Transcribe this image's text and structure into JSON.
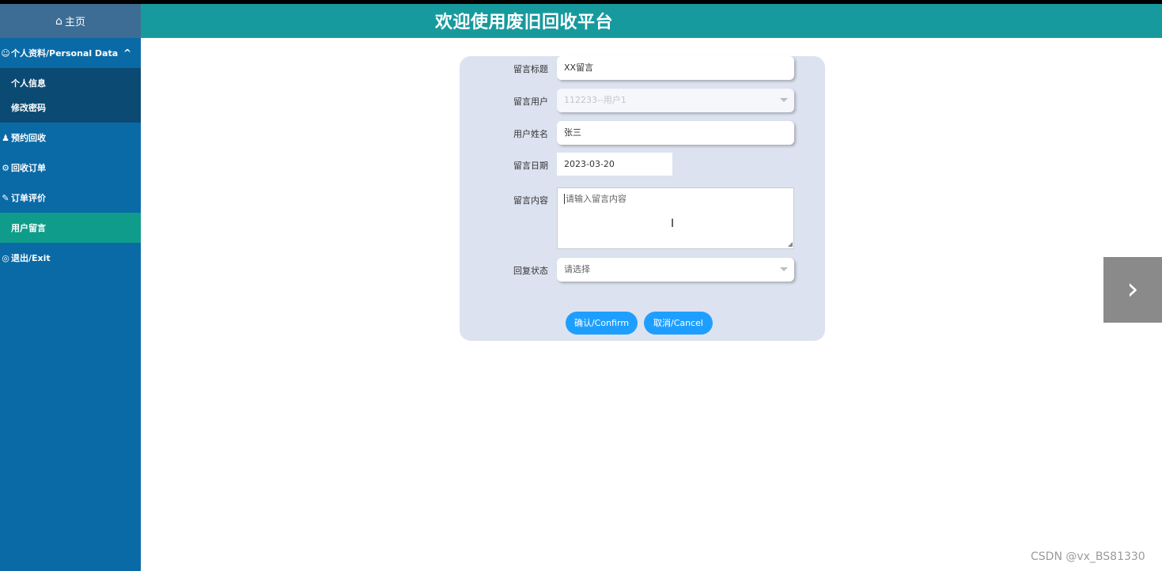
{
  "header": {
    "title": "欢迎使用废旧回收平台"
  },
  "sidebar": {
    "home": {
      "icon": "⌂",
      "label": "主页"
    },
    "group": {
      "label": "个人资料/Personal Data",
      "chevron": "^"
    },
    "sub_items": [
      {
        "label": "个人信息"
      },
      {
        "label": "修改密码"
      }
    ],
    "items": [
      {
        "label": "预约回收"
      },
      {
        "label": "回收订单"
      },
      {
        "label": "订单评价"
      },
      {
        "label": "用户留言"
      },
      {
        "label": "退出/Exit"
      }
    ],
    "active_item": "用户留言"
  },
  "form": {
    "title": {
      "label": "留言标题",
      "value": "XX留言"
    },
    "user": {
      "label": "留言用户",
      "value": "112233--用户1"
    },
    "name": {
      "label": "用户姓名",
      "value": "张三"
    },
    "date": {
      "label": "留言日期",
      "value": "2023-03-20"
    },
    "content": {
      "label": "留言内容",
      "placeholder": "请输入留言内容"
    },
    "status": {
      "label": "回复状态",
      "placeholder": "请选择"
    },
    "confirm_label": "确认/Confirm",
    "cancel_label": "取消/Cancel"
  },
  "next_button": {
    "icon": "›"
  },
  "watermark": "CSDN @vx_BS81330",
  "colors": {
    "sidebar": "#0a6aa6",
    "header": "#179a9e",
    "active": "#109c8a",
    "card": "#dde2f0",
    "button": "#1e9fff"
  }
}
